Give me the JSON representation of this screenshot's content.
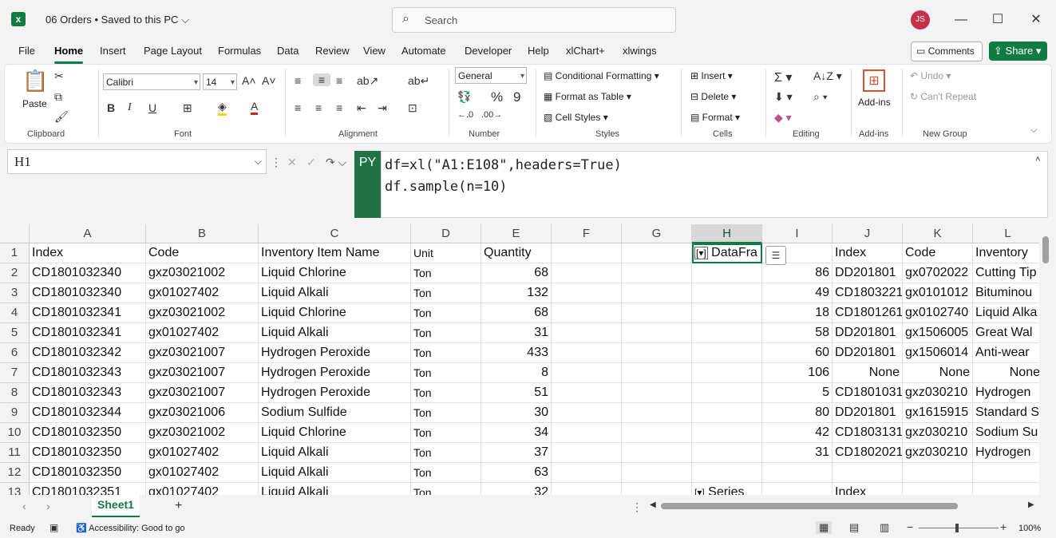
{
  "title_bar": {
    "file_name": "06 Orders",
    "save_status": "Saved to this PC",
    "search_placeholder": "Search",
    "user_initials": "JS"
  },
  "tabs": [
    "File",
    "Home",
    "Insert",
    "Page Layout",
    "Formulas",
    "Data",
    "Review",
    "View",
    "Automate",
    "Developer",
    "Help",
    "xlChart+",
    "xlwings"
  ],
  "active_tab": "Home",
  "header_buttons": {
    "comments": "Comments",
    "share": "Share"
  },
  "ribbon": {
    "clipboard": {
      "label": "Clipboard",
      "paste": "Paste"
    },
    "font": {
      "label": "Font",
      "family": "Calibri",
      "size": "14"
    },
    "alignment": {
      "label": "Alignment"
    },
    "number": {
      "label": "Number",
      "format": "General"
    },
    "styles": {
      "label": "Styles",
      "conditional": "Conditional Formatting",
      "format_table": "Format as Table",
      "cell_styles": "Cell Styles"
    },
    "cells": {
      "label": "Cells",
      "insert": "Insert",
      "delete": "Delete",
      "format": "Format"
    },
    "editing": {
      "label": "Editing"
    },
    "addins": {
      "label": "Add-ins",
      "button": "Add-ins"
    },
    "new_group": {
      "label": "New Group",
      "undo": "Undo",
      "redo": "Can't Repeat"
    }
  },
  "formula_bar": {
    "name_box": "H1",
    "badge": "PY",
    "line1": "df=xl(\"A1:E108\",headers=True)",
    "line2": "df.sample(n=10)"
  },
  "grid": {
    "columns": [
      "A",
      "B",
      "C",
      "D",
      "E",
      "F",
      "G",
      "H",
      "I",
      "J",
      "K",
      "L"
    ],
    "row_numbers": [
      "1",
      "2",
      "3",
      "4",
      "5",
      "6",
      "7",
      "8",
      "9",
      "10",
      "11",
      "12",
      "13"
    ],
    "headers": [
      "Index",
      "Code",
      "Inventory Item Name",
      "Unit",
      "Quantity"
    ],
    "rows": [
      [
        "CD1801032340",
        "gxz03021002",
        "Liquid Chlorine",
        "Ton",
        "68"
      ],
      [
        "CD1801032340",
        "gx01027402",
        "Liquid Alkali",
        "Ton",
        "132"
      ],
      [
        "CD1801032341",
        "gxz03021002",
        "Liquid Chlorine",
        "Ton",
        "68"
      ],
      [
        "CD1801032341",
        "gx01027402",
        "Liquid Alkali",
        "Ton",
        "31"
      ],
      [
        "CD1801032342",
        "gxz03021007",
        "Hydrogen Peroxide",
        "Ton",
        "433"
      ],
      [
        "CD1801032343",
        "gxz03021007",
        "Hydrogen Peroxide",
        "Ton",
        "8"
      ],
      [
        "CD1801032343",
        "gxz03021007",
        "Hydrogen Peroxide",
        "Ton",
        "51"
      ],
      [
        "CD1801032344",
        "gxz03021006",
        "Sodium Sulfide",
        "Ton",
        "30"
      ],
      [
        "CD1801032350",
        "gxz03021002",
        "Liquid Chlorine",
        "Ton",
        "34"
      ],
      [
        "CD1801032350",
        "gx01027402",
        "Liquid Alkali",
        "Ton",
        "37"
      ],
      [
        "CD1801032350",
        "gx01027402",
        "Liquid Alkali",
        "Ton",
        "63"
      ],
      [
        "CD1801032351",
        "gx01027402",
        "Liquid Alkali",
        "Ton",
        "32"
      ]
    ],
    "h1": "DataFra",
    "h13": "Series",
    "spill_headers": [
      "Index",
      "Code",
      "Inventory"
    ],
    "spill_rows": [
      [
        "86",
        "DD201801",
        "gx0702022",
        "Cutting Tip"
      ],
      [
        "49",
        "CD1803221",
        "gx0101012",
        "Bituminou"
      ],
      [
        "18",
        "CD1801261",
        "gx0102740",
        "Liquid Alka"
      ],
      [
        "58",
        "DD201801",
        "gx1506005",
        "Great Wal"
      ],
      [
        "60",
        "DD201801",
        "gx1506014",
        "Anti-wear"
      ],
      [
        "106",
        "None",
        "None",
        "None"
      ],
      [
        "5",
        "CD1801031",
        "gxz030210",
        "Hydrogen"
      ],
      [
        "80",
        "DD201801",
        "gx1615915",
        "Standard S"
      ],
      [
        "42",
        "CD1803131",
        "gxz030210",
        "Sodium Su"
      ],
      [
        "31",
        "CD1802021",
        "gxz030210",
        "Hydrogen"
      ]
    ],
    "j13": "Index"
  },
  "sheets": [
    "Sheet1"
  ],
  "status": {
    "ready": "Ready",
    "accessibility": "Accessibility: Good to go",
    "zoom": "100%"
  }
}
